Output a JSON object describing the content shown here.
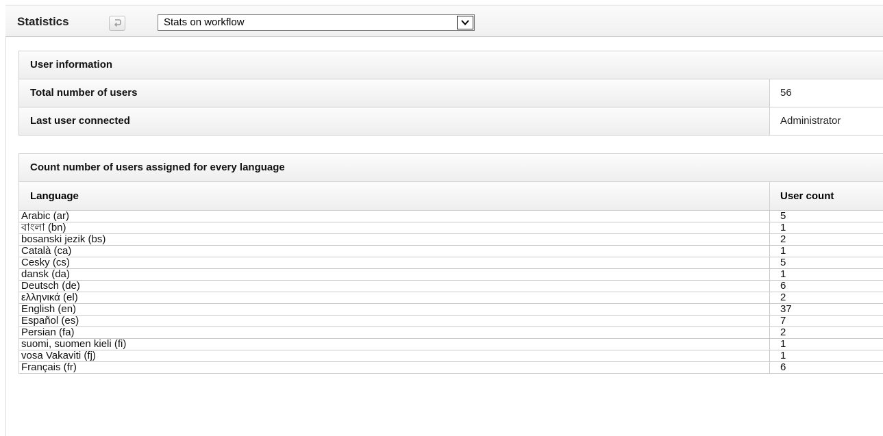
{
  "header": {
    "title": "Statistics",
    "refresh_icon": "refresh-icon",
    "stats_select": {
      "selected": "Stats on workflow",
      "arrow_icon": "chevron-down-icon"
    }
  },
  "user_info": {
    "heading": "User information",
    "rows": [
      {
        "label": "Total number of users",
        "value": "56"
      },
      {
        "label": "Last user connected",
        "value": "Administrator"
      }
    ]
  },
  "languages": {
    "heading": "Count number of users assigned for every language",
    "columns": {
      "language": "Language",
      "count": "User count"
    },
    "rows": [
      {
        "language": "Arabic (ar)",
        "count": "5"
      },
      {
        "language": "বাংলা (bn)",
        "count": "1"
      },
      {
        "language": "bosanski jezik (bs)",
        "count": "2"
      },
      {
        "language": "Català (ca)",
        "count": "1"
      },
      {
        "language": "Cesky (cs)",
        "count": "5"
      },
      {
        "language": "dansk (da)",
        "count": "1"
      },
      {
        "language": "Deutsch (de)",
        "count": "6"
      },
      {
        "language": "ελληνικά (el)",
        "count": "2"
      },
      {
        "language": "English (en)",
        "count": "37"
      },
      {
        "language": "Español (es)",
        "count": "7"
      },
      {
        "language": "Persian (fa)",
        "count": "2"
      },
      {
        "language": "suomi, suomen kieli (fi)",
        "count": "1"
      },
      {
        "language": "vosa Vakaviti (fj)",
        "count": "1"
      },
      {
        "language": "Français (fr)",
        "count": "6"
      }
    ]
  }
}
